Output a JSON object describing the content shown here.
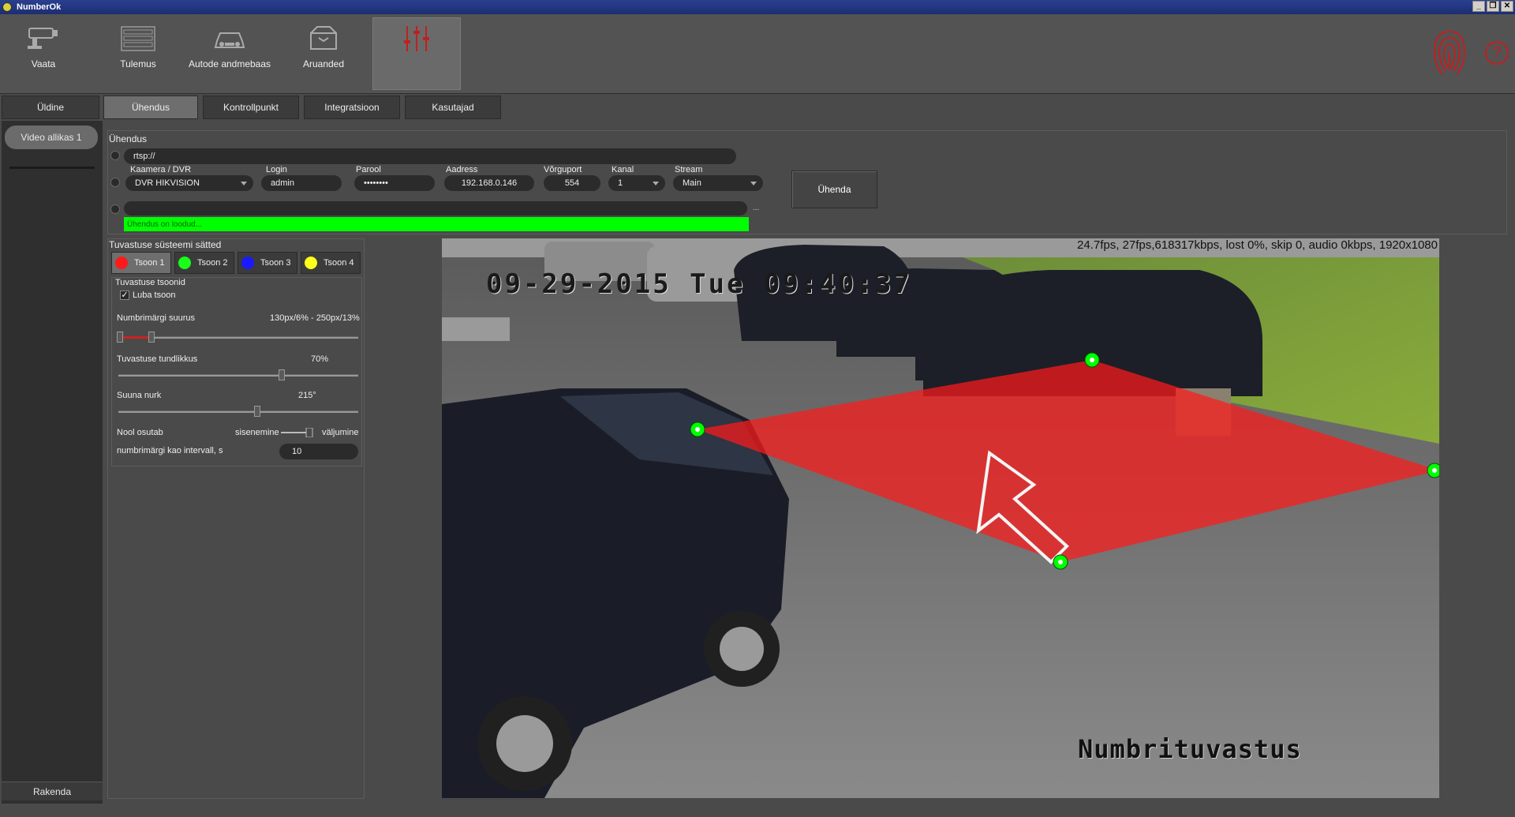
{
  "window": {
    "title": "NumberOk",
    "buttons": [
      "_",
      "❐",
      "✕"
    ]
  },
  "toolbar": {
    "items": [
      {
        "label": "Vaata",
        "icon": "camera-icon"
      },
      {
        "label": "Tulemus",
        "icon": "results-list-icon"
      },
      {
        "label": "Autode andmebaas",
        "icon": "car-database-icon"
      },
      {
        "label": "Aruanded",
        "icon": "reports-icon"
      },
      {
        "label": "",
        "icon": "settings-sliders-icon",
        "active": true
      }
    ],
    "help": "?"
  },
  "tabs": [
    {
      "label": "Üldine"
    },
    {
      "label": "Ühendus",
      "active": true
    },
    {
      "label": "Kontrollpunkt"
    },
    {
      "label": "Integratsioon"
    },
    {
      "label": "Kasutajad"
    }
  ],
  "sidebar": {
    "source": "Video allikas 1",
    "apply": "Rakenda"
  },
  "connection": {
    "title": "Ühendus",
    "rtsp_value": "rtsp://",
    "camera_label": "Kaamera / DVR",
    "camera_value": "DVR HIKVISION",
    "login_label": "Login",
    "login_value": "admin",
    "password_label": "Parool",
    "password_value": "••••••••",
    "address_label": "Aadress",
    "address_value": "192.168.0.146",
    "port_label": "Võrguport",
    "port_value": "554",
    "channel_label": "Kanal",
    "channel_value": "1",
    "stream_label": "Stream",
    "stream_value": "Main",
    "connect_button": "Ühenda",
    "extra_button": "...",
    "status": "Ühendus on loodud..."
  },
  "detection": {
    "title": "Tuvastuse süsteemi sätted",
    "zones": [
      {
        "label": "Tsoon 1",
        "color": "#ff1a1a",
        "active": true
      },
      {
        "label": "Tsoon 2",
        "color": "#1aff1a"
      },
      {
        "label": "Tsoon 3",
        "color": "#1a1aff"
      },
      {
        "label": "Tsoon 4",
        "color": "#ffff1a"
      }
    ],
    "zones_title": "Tuvastuse tsoonid",
    "enable_zone": "Luba tsoon",
    "enable_zone_checked": true,
    "plate_size_label": "Numbrimärgi suurus",
    "plate_size_value": "130px/6% - 250px/13%",
    "sensitivity_label": "Tuvastuse tundlikkus",
    "sensitivity_value": "70%",
    "sensitivity_level": 0.7,
    "direction_label": "Suuna nurk",
    "direction_value": "215°",
    "arrow_label": "Nool osutab",
    "arrow_in": "sisenemine",
    "arrow_out": "väljumine",
    "interval_label": "numbrimärgi kao intervall, s",
    "interval_value": "10"
  },
  "video": {
    "stats": "24.7fps, 27fps,618317kbps, lost 0%, skip 0, audio 0kbps, 1920x1080",
    "osd_date": "09-29-2015 Tue 09:40:37",
    "osd_label": "Numbrituvastus"
  }
}
